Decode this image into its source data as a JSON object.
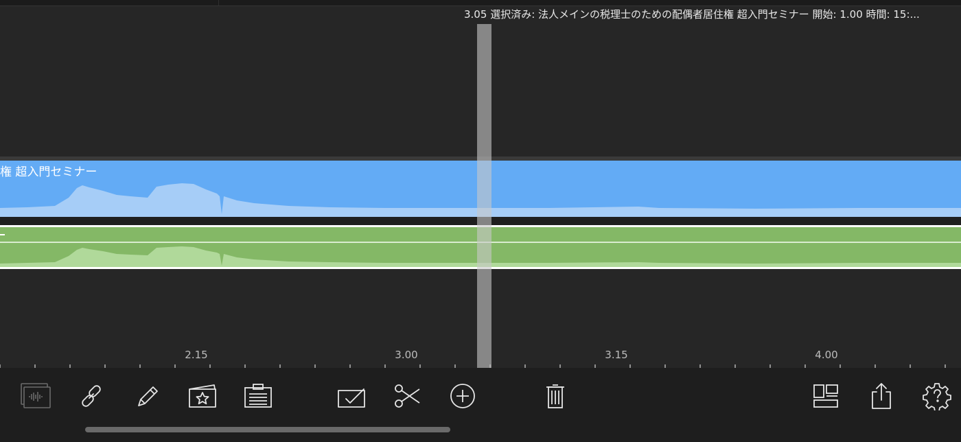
{
  "status": {
    "playhead_time": "3.05",
    "selection_text": "選択済み: 法人メインの税理士のための配偶者居住権 超入門セミナー 開始: 1.00 時間: 15:..."
  },
  "tracks": {
    "blue_clip_title": "権 超入門セミナー",
    "green_clip_marker": "-"
  },
  "ruler": {
    "labels": [
      "2.15",
      "3.00",
      "3.15",
      "4.00"
    ]
  },
  "toolbar": {
    "icons": [
      "audio-clip-icon",
      "link-icon",
      "pencil-icon",
      "favorite-card-icon",
      "clipboard-icon",
      "checkbox-icon",
      "scissors-icon",
      "add-circle-icon",
      "trash-icon",
      "layout-icon",
      "share-icon",
      "help-gear-icon"
    ]
  },
  "colors": {
    "background": "#262626",
    "toolbar": "#1e1e1e",
    "blue_clip": "#63abf5",
    "blue_wave": "#a6cdf7",
    "green_clip": "#84b866",
    "green_wave": "#b0d99a",
    "playhead": "#c8c8c8"
  }
}
